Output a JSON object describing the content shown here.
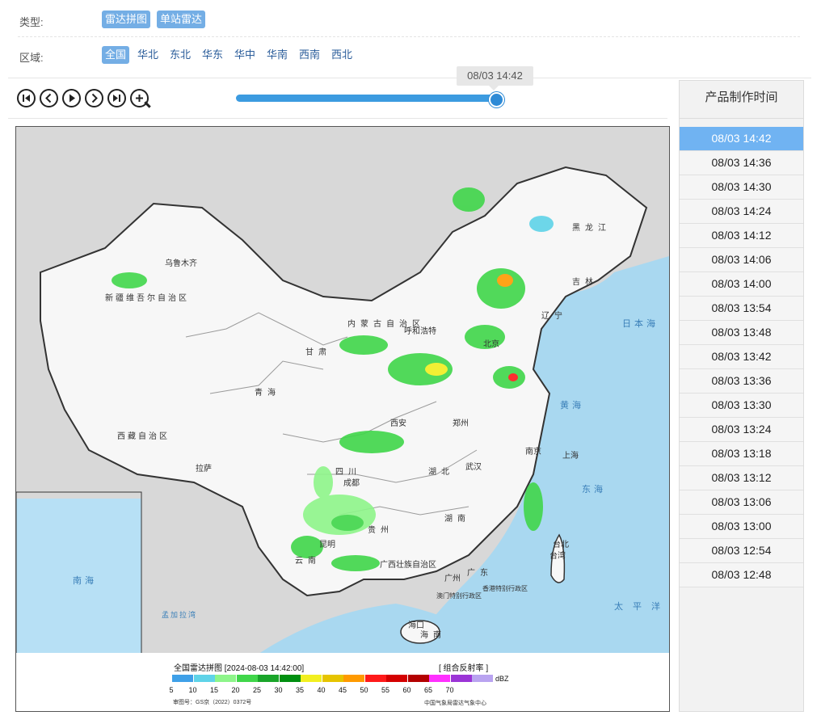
{
  "filters": {
    "type_label": "类型:",
    "type_options": [
      "雷达拼图",
      "单站雷达"
    ],
    "region_label": "区域:",
    "region_options": [
      "全国",
      "华北",
      "东北",
      "华东",
      "华中",
      "华南",
      "西南",
      "西北"
    ]
  },
  "player": {
    "tooltip": "08/03 14:42",
    "progress": 1.0
  },
  "map": {
    "labels": {
      "xinjiang": "新疆维吾尔自治区",
      "urumqi": "乌鲁木齐",
      "tibet": "西藏自治区",
      "lhasa": "拉萨",
      "qinghai": "青海",
      "gansu": "甘肃",
      "neimeng": "内蒙古自治区",
      "huhehaote": "呼和浩特",
      "heilongjiang": "黑龙江",
      "jilin": "吉林",
      "liaoning": "辽宁",
      "sichuan": "四川",
      "chengdu": "成都",
      "hubei": "湖北",
      "wuhan": "武汉",
      "hunan": "湖南",
      "guizhou": "贵州",
      "yunnan": "云南",
      "kunming": "昆明",
      "guangxi": "广西壮族自治区",
      "guangdong": "广东",
      "guangzhou": "广州",
      "hainan": "海南",
      "haikou": "海口",
      "taiwan": "台湾",
      "taibei": "台北",
      "zhengzhou": "郑州",
      "xian": "西安",
      "beijing": "北京",
      "nanjing": "南京",
      "shanghai": "上海",
      "hk": "香港特别行政区",
      "macau": "澳门特别行政区"
    },
    "seas": {
      "japan_sea": "日本海",
      "yellow_sea": "黄海",
      "east_sea": "东海",
      "pacific": "太平洋",
      "south_sea": "南海",
      "bengal": "孟加拉湾"
    }
  },
  "legend": {
    "title": "全国雷达拼图 [2024-08-03 14:42:00]",
    "kind": "[ 组合反射率 ]",
    "unit": "dBZ",
    "values": [
      "5",
      "10",
      "15",
      "20",
      "25",
      "30",
      "35",
      "40",
      "45",
      "50",
      "55",
      "60",
      "65",
      "70"
    ],
    "colors": [
      "#3fa0e8",
      "#5fd3e8",
      "#8ef58a",
      "#40d64a",
      "#1aa52a",
      "#008f10",
      "#f2ef20",
      "#e6c400",
      "#ff9a00",
      "#ff1a1a",
      "#d40000",
      "#b30000",
      "#ff30ff",
      "#9b34d6",
      "#b9a3f0"
    ],
    "footer_left": "审图号：GS京（2022）0372号",
    "footer_right": "中国气象局雷达气象中心"
  },
  "time_panel": {
    "header": "产品制作时间",
    "items": [
      "08/03 14:42",
      "08/03 14:36",
      "08/03 14:30",
      "08/03 14:24",
      "08/03 14:12",
      "08/03 14:06",
      "08/03 14:00",
      "08/03 13:54",
      "08/03 13:48",
      "08/03 13:42",
      "08/03 13:36",
      "08/03 13:30",
      "08/03 13:24",
      "08/03 13:18",
      "08/03 13:12",
      "08/03 13:06",
      "08/03 13:00",
      "08/03 12:54",
      "08/03 12:48"
    ],
    "selected_index": 0
  }
}
